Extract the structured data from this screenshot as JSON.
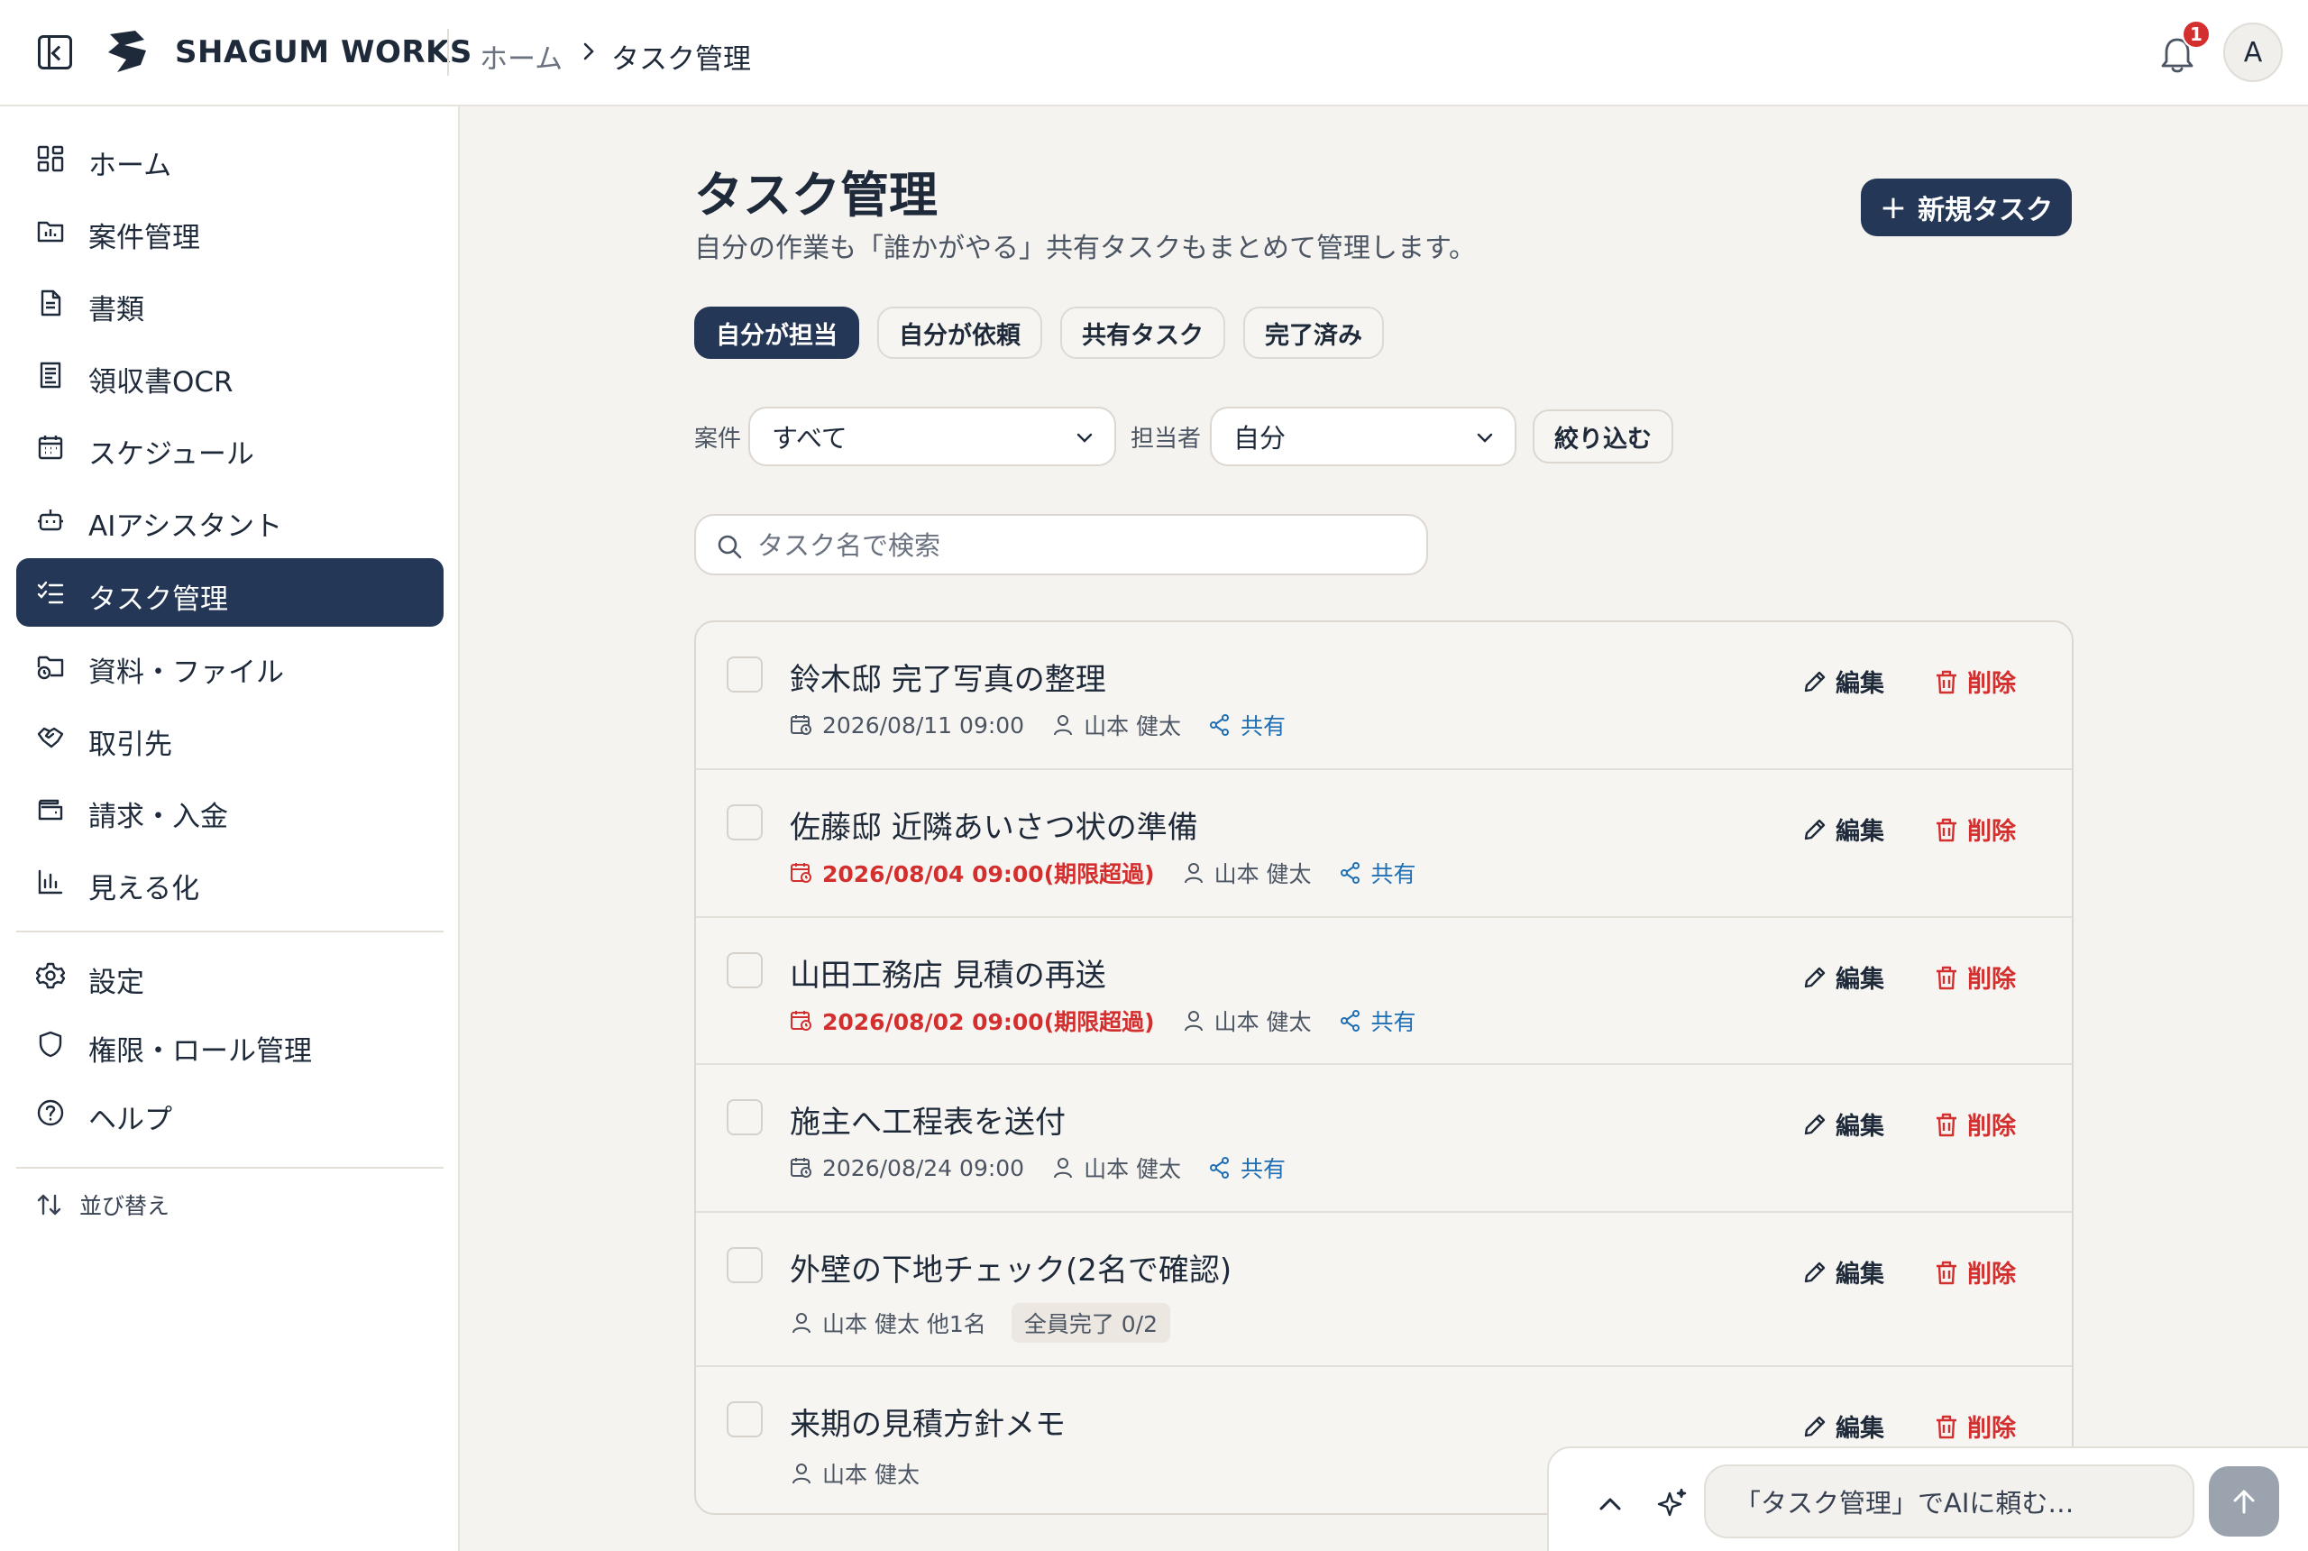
{
  "header": {
    "brand": "SHAGUM WORKS",
    "breadcrumb": [
      "ホーム",
      "タスク管理"
    ],
    "notification_count": "1",
    "avatar_initial": "A"
  },
  "sidebar": {
    "items": [
      {
        "label": "ホーム",
        "icon": "grid-icon"
      },
      {
        "label": "案件管理",
        "icon": "folder-chart-icon"
      },
      {
        "label": "書類",
        "icon": "document-icon"
      },
      {
        "label": "領収書OCR",
        "icon": "receipt-icon"
      },
      {
        "label": "スケジュール",
        "icon": "calendar-icon"
      },
      {
        "label": "AIアシスタント",
        "icon": "bot-icon"
      },
      {
        "label": "タスク管理",
        "icon": "checklist-icon",
        "active": true
      },
      {
        "label": "資料・ファイル",
        "icon": "folder-clock-icon"
      },
      {
        "label": "取引先",
        "icon": "handshake-icon"
      },
      {
        "label": "請求・入金",
        "icon": "wallet-icon"
      },
      {
        "label": "見える化",
        "icon": "bar-chart-icon"
      }
    ],
    "secondary": [
      {
        "label": "設定",
        "icon": "gear-icon"
      },
      {
        "label": "権限・ロール管理",
        "icon": "shield-icon"
      },
      {
        "label": "ヘルプ",
        "icon": "help-circle-icon"
      }
    ],
    "sort_label": "並び替え"
  },
  "page": {
    "title": "タスク管理",
    "subtitle": "自分の作業も「誰かがやる」共有タスクもまとめて管理します。",
    "new_task_label": "新規タスク"
  },
  "tabs": [
    {
      "label": "自分が担当",
      "active": true
    },
    {
      "label": "自分が依頼",
      "active": false
    },
    {
      "label": "共有タスク",
      "active": false
    },
    {
      "label": "完了済み",
      "active": false
    }
  ],
  "filters": {
    "project_label": "案件",
    "project_value": "すべて",
    "assignee_label": "担当者",
    "assignee_value": "自分",
    "apply_label": "絞り込む"
  },
  "search": {
    "placeholder": "タスク名で検索"
  },
  "actions": {
    "edit": "編集",
    "delete": "削除"
  },
  "tasks": [
    {
      "title": "鈴木邸 完了写真の整理",
      "due": "2026/08/11 09:00",
      "overdue": false,
      "assignee": "山本 健太",
      "shared": "共有"
    },
    {
      "title": "佐藤邸 近隣あいさつ状の準備",
      "due": "2026/08/04 09:00(期限超過)",
      "overdue": true,
      "assignee": "山本 健太",
      "shared": "共有"
    },
    {
      "title": "山田工務店 見積の再送",
      "due": "2026/08/02 09:00(期限超過)",
      "overdue": true,
      "assignee": "山本 健太",
      "shared": "共有"
    },
    {
      "title": "施主へ工程表を送付",
      "due": "2026/08/24 09:00",
      "overdue": false,
      "assignee": "山本 健太",
      "shared": "共有"
    },
    {
      "title": "外壁の下地チェック(2名で確認)",
      "assignee": "山本 健太 他1名",
      "progress": "全員完了 0/2"
    },
    {
      "title": "来期の見積方針メモ",
      "assignee": "山本 健太"
    }
  ],
  "ai_bar": {
    "placeholder": "「タスク管理」でAIに頼む…"
  },
  "colors": {
    "primary": "#243757",
    "danger": "#d32f2f",
    "link": "#1f6fb5",
    "background": "#f5f3ef"
  }
}
